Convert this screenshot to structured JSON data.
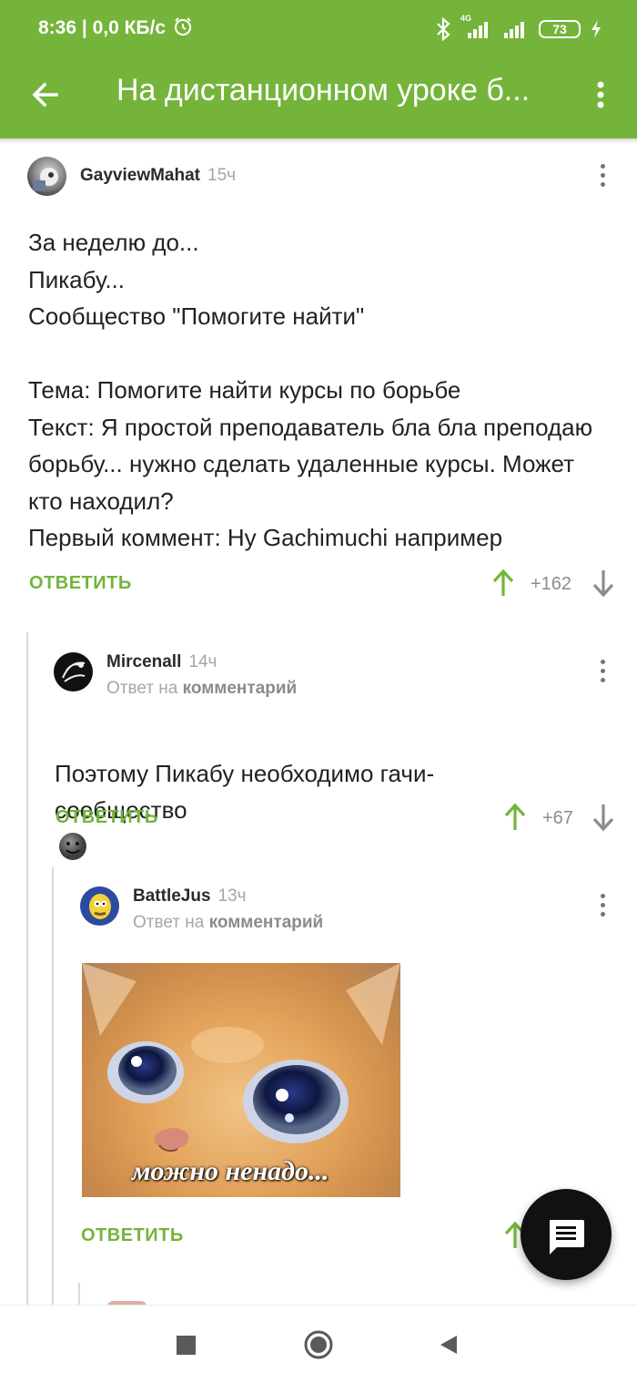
{
  "status_bar": {
    "time": "8:36",
    "speed": "| 0,0 КБ/с",
    "network": "4G",
    "battery": "73"
  },
  "toolbar": {
    "title": "На дистанционном уроке б..."
  },
  "comments": [
    {
      "author": "GayviewMahat",
      "time": "15ч",
      "text": "За неделю до...\nПикабу...\nСообщество \"Помогите найти\"\n\nТема: Помогите найти курсы по борьбе\nТекст: Я простой преподаватель бла бла преподаю борьбу... нужно сделать удаленные курсы. Может кто находил?\nПервый коммент: Ну Gachimuchi например",
      "reply_label": "ОТВЕТИТЬ",
      "score": "+162"
    },
    {
      "author": "Mircenall",
      "time": "14ч",
      "reply_to_prefix": "Ответ на",
      "reply_to_link": "комментарий",
      "text": "Поэтому Пикабу необходимо гачи-сообщество",
      "reply_label": "ОТВЕТИТЬ",
      "score": "+67"
    },
    {
      "author": "BattleJus",
      "time": "13ч",
      "reply_to_prefix": "Ответ на",
      "reply_to_link": "комментарий",
      "image_caption": "можно ненадо...",
      "reply_label": "ОТВЕТИТЬ"
    }
  ],
  "colors": {
    "brand": "#75b43b",
    "text": "#222222",
    "muted": "#a6a6a6"
  },
  "icons": [
    "back-arrow-icon",
    "more-vert-icon",
    "bluetooth-icon",
    "signal-icon",
    "battery-icon",
    "upvote-icon",
    "downvote-icon",
    "comment-fab-icon",
    "nav-stop-icon",
    "nav-home-icon",
    "nav-back-icon",
    "alarm-icon",
    "charging-icon"
  ]
}
